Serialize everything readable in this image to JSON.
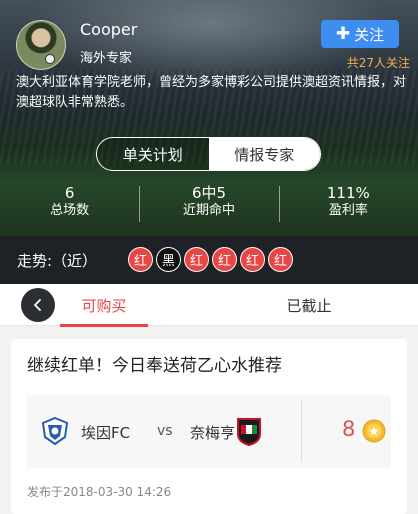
{
  "expert": {
    "name": "Cooper",
    "title": "海外专家",
    "follow_label": "关注",
    "follower_text": "共27人关注",
    "description": "澳大利亚体育学院老师，曾经为多家博彩公司提供澳超资讯情报，对澳超球队非常熟悉。"
  },
  "segment": {
    "tabs": [
      "单关计划",
      "情报专家"
    ],
    "active_index": 1
  },
  "stats": [
    {
      "value": "6",
      "label": "总场数"
    },
    {
      "value": "6中5",
      "label": "近期命中"
    },
    {
      "value": "111%",
      "label": "盈利率"
    }
  ],
  "trend": {
    "label": "走势:（近）",
    "results": [
      {
        "text": "红",
        "type": "red"
      },
      {
        "text": "黑",
        "type": "black"
      },
      {
        "text": "红",
        "type": "red"
      },
      {
        "text": "红",
        "type": "red"
      },
      {
        "text": "红",
        "type": "red"
      },
      {
        "text": "红",
        "type": "red"
      }
    ]
  },
  "tabs": {
    "buy_label": "可购买",
    "closed_label": "已截止",
    "active": "buy"
  },
  "plan": {
    "title": "继续红单！今日奉送荷乙心水推荐",
    "home_team": "埃因FC",
    "vs": "vs",
    "away_team": "奈梅亨",
    "price": "8",
    "published": "发布于2018-03-30 14:26"
  },
  "colors": {
    "accent_red": "#e84545",
    "follow_blue": "#3d8ef0",
    "follower_orange": "#f0b050",
    "trend_bg": "#1e2227"
  },
  "icons": {
    "back": "chevron-left-icon",
    "follow": "plus-icon",
    "coin": "coin-icon",
    "home_team": "team-crest-icon",
    "away_team": "team-crest-icon"
  }
}
